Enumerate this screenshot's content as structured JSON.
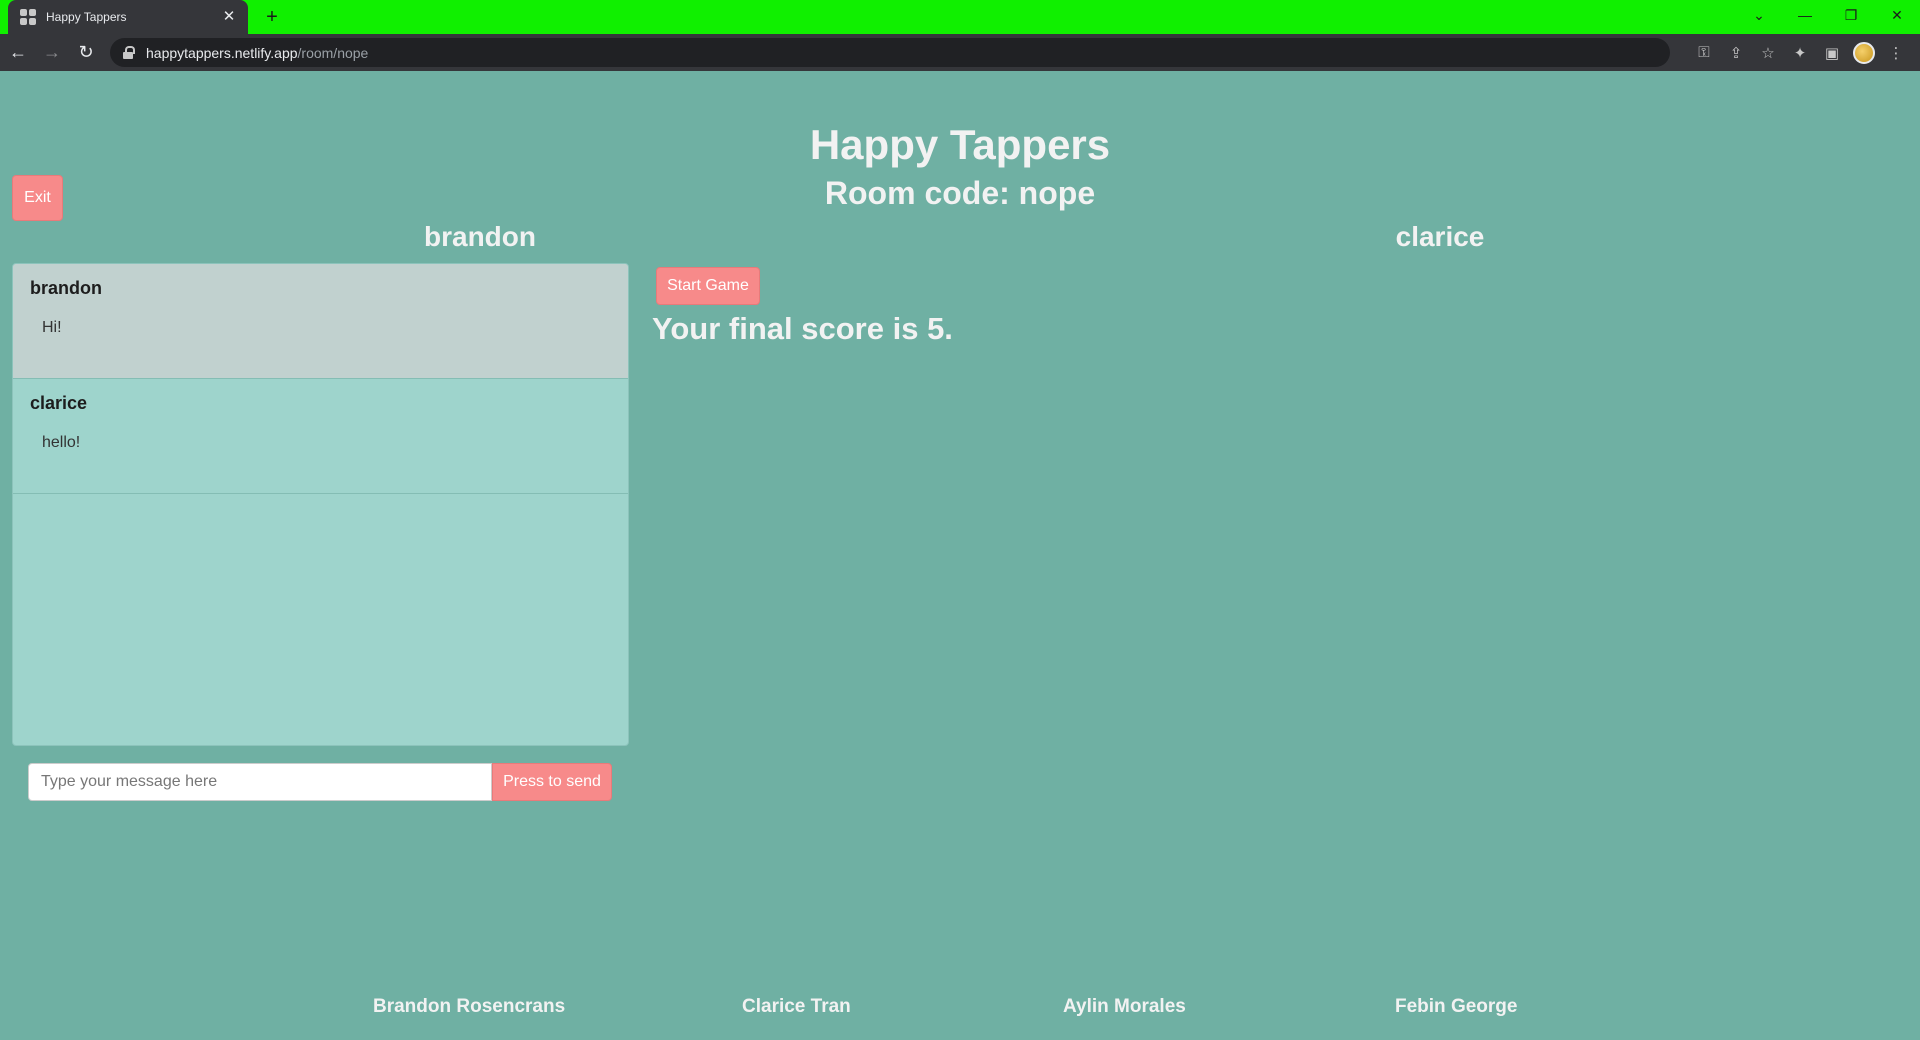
{
  "browser": {
    "tab_title": "Happy Tappers",
    "tab_close": "✕",
    "new_tab": "+",
    "url_host": "happytappers.netlify.app",
    "url_path": "/room/nope",
    "back": "←",
    "forward": "→",
    "reload": "↻",
    "tab_search": "⌄",
    "minimize": "—",
    "restore": "❐",
    "close": "✕",
    "key_icon": "⚿",
    "share_icon": "⇪",
    "star_icon": "☆",
    "extensions_icon": "✦",
    "sidepanel_icon": "▣",
    "menu_icon": "⋮",
    "tab_strip_color": "#10f000"
  },
  "app": {
    "title": "Happy Tappers",
    "room_code": "Room code: nope",
    "exit_label": "Exit",
    "background_color": "#6fb0a3",
    "accent_color": "#f78a8a"
  },
  "players": {
    "left": "brandon",
    "right": "clarice"
  },
  "chat": {
    "messages": [
      {
        "author": "brandon",
        "text": "Hi!"
      },
      {
        "author": "clarice",
        "text": "hello!"
      }
    ],
    "input_value": "",
    "input_placeholder": "Type your message here",
    "send_label": "Press to send"
  },
  "game": {
    "start_label": "Start Game",
    "final_score_text": "Your final score is 5."
  },
  "footer": {
    "credits": [
      "Brandon Rosencrans",
      "Clarice Tran",
      "Aylin Morales",
      "Febin George"
    ]
  }
}
